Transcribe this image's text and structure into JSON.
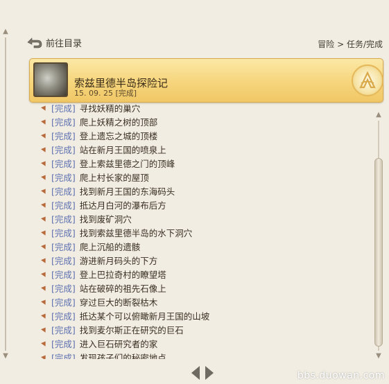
{
  "nav": {
    "back_label": "前往目录",
    "breadcrumb": "冒险 > 任务/完成"
  },
  "header": {
    "title": "索兹里德半岛探险记",
    "meta": "15. 09. 25 [完成]"
  },
  "quests": [
    {
      "status": "[完成]",
      "text": "寻找妖精的巢穴"
    },
    {
      "status": "[完成]",
      "text": "爬上妖精之树的顶部"
    },
    {
      "status": "[完成]",
      "text": "登上遗忘之城的顶楼"
    },
    {
      "status": "[完成]",
      "text": "站在新月王国的喷泉上"
    },
    {
      "status": "[完成]",
      "text": "登上索兹里德之门的顶峰"
    },
    {
      "status": "[完成]",
      "text": "爬上村长家的屋顶"
    },
    {
      "status": "[完成]",
      "text": "找到新月王国的东海码头"
    },
    {
      "status": "[完成]",
      "text": "抵达月白河的瀑布后方"
    },
    {
      "status": "[完成]",
      "text": "找到废矿洞穴"
    },
    {
      "status": "[完成]",
      "text": "找到索兹里德半岛的水下洞穴"
    },
    {
      "status": "[完成]",
      "text": "爬上沉船的遗骸"
    },
    {
      "status": "[完成]",
      "text": "游进新月码头的下方"
    },
    {
      "status": "[完成]",
      "text": "登上巴拉奇村的瞭望塔"
    },
    {
      "status": "[完成]",
      "text": "站在破碎的祖先石像上"
    },
    {
      "status": "[完成]",
      "text": "穿过巨大的断裂枯木"
    },
    {
      "status": "[完成]",
      "text": "抵达某个可以俯瞰新月王国的山坡"
    },
    {
      "status": "[完成]",
      "text": "找到麦尔斯正在研究的巨石"
    },
    {
      "status": "[完成]",
      "text": "进入巨石研究者的家"
    },
    {
      "status": "[完成]",
      "text": "发现孩子们的秘密地点"
    }
  ],
  "watermark": "bbs.duowan.com",
  "colors": {
    "status": "#5b6fb0",
    "header_bg": "#f6d57c",
    "page_bg": "#f1ede2"
  },
  "icons": {
    "back": "back-arrow-icon",
    "emblem": "archeage-emblem-icon",
    "bullet": "quill-bullet-icon"
  }
}
